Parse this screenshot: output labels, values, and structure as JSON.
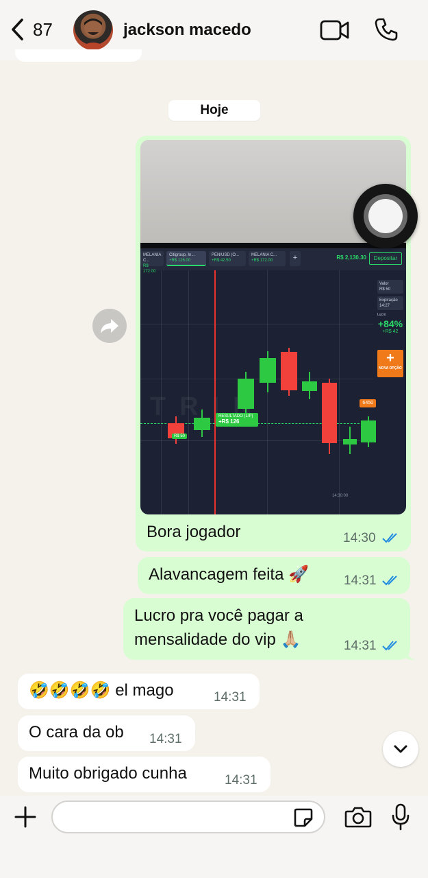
{
  "header": {
    "back_count": "87",
    "contact_name": "jackson macedo",
    "icons": [
      "chevron-left-icon",
      "avatar",
      "video-camera-icon",
      "phone-icon"
    ]
  },
  "date_separator": "Hoje",
  "screenshot": {
    "tabs": [
      {
        "label": "MELANIA C...",
        "value": "R$ 172.00"
      },
      {
        "label": "Citigroup, In...",
        "value": "+R$ 126.00"
      },
      {
        "label": "PEN/USD (O...",
        "value": "+R$ 42.50"
      },
      {
        "label": "MELANIA C...",
        "value": "+R$ 172.00"
      }
    ],
    "balance": "R$ 2,130.30",
    "deposit_label": "Depositar",
    "panel": {
      "value_label": "Valor",
      "value": "R$ 50",
      "expiry_label": "Expiração",
      "expiry": "14:27",
      "profit_label": "Lucro",
      "percent": "+84%",
      "profit_value": "+R$ 42"
    },
    "new_option_label": "NOVA OPÇÃO",
    "result_label": "RESULTADO (L/P)",
    "result_value": "+R$ 126",
    "stake_tag": "R$ 50",
    "price_tag": "6450",
    "watermark": "TRIN",
    "time_axis": "14:30:00"
  },
  "messages": {
    "outgoing": [
      {
        "text": "Bora jogador",
        "time": "14:30"
      },
      {
        "text": "Alavancagem feita 🚀",
        "time": "14:31"
      },
      {
        "line1": "Lucro pra você pagar a",
        "line2": "mensalidade do vip 🙏🏼",
        "time": "14:31"
      }
    ],
    "incoming": [
      {
        "text": "🤣🤣🤣🤣 el mago",
        "time": "14:31"
      },
      {
        "text": "O cara da ob",
        "time": "14:31"
      },
      {
        "text": "Muito obrigado cunha",
        "time": "14:31"
      }
    ]
  },
  "composer": {
    "placeholder": "",
    "icons": [
      "plus-icon",
      "sticker-icon",
      "camera-icon",
      "microphone-icon"
    ]
  },
  "colors": {
    "outgoing_bubble": "#d9fdd3",
    "incoming_bubble": "#ffffff",
    "chat_background": "#f5f2ec",
    "read_ticks": "#1f8be0"
  }
}
